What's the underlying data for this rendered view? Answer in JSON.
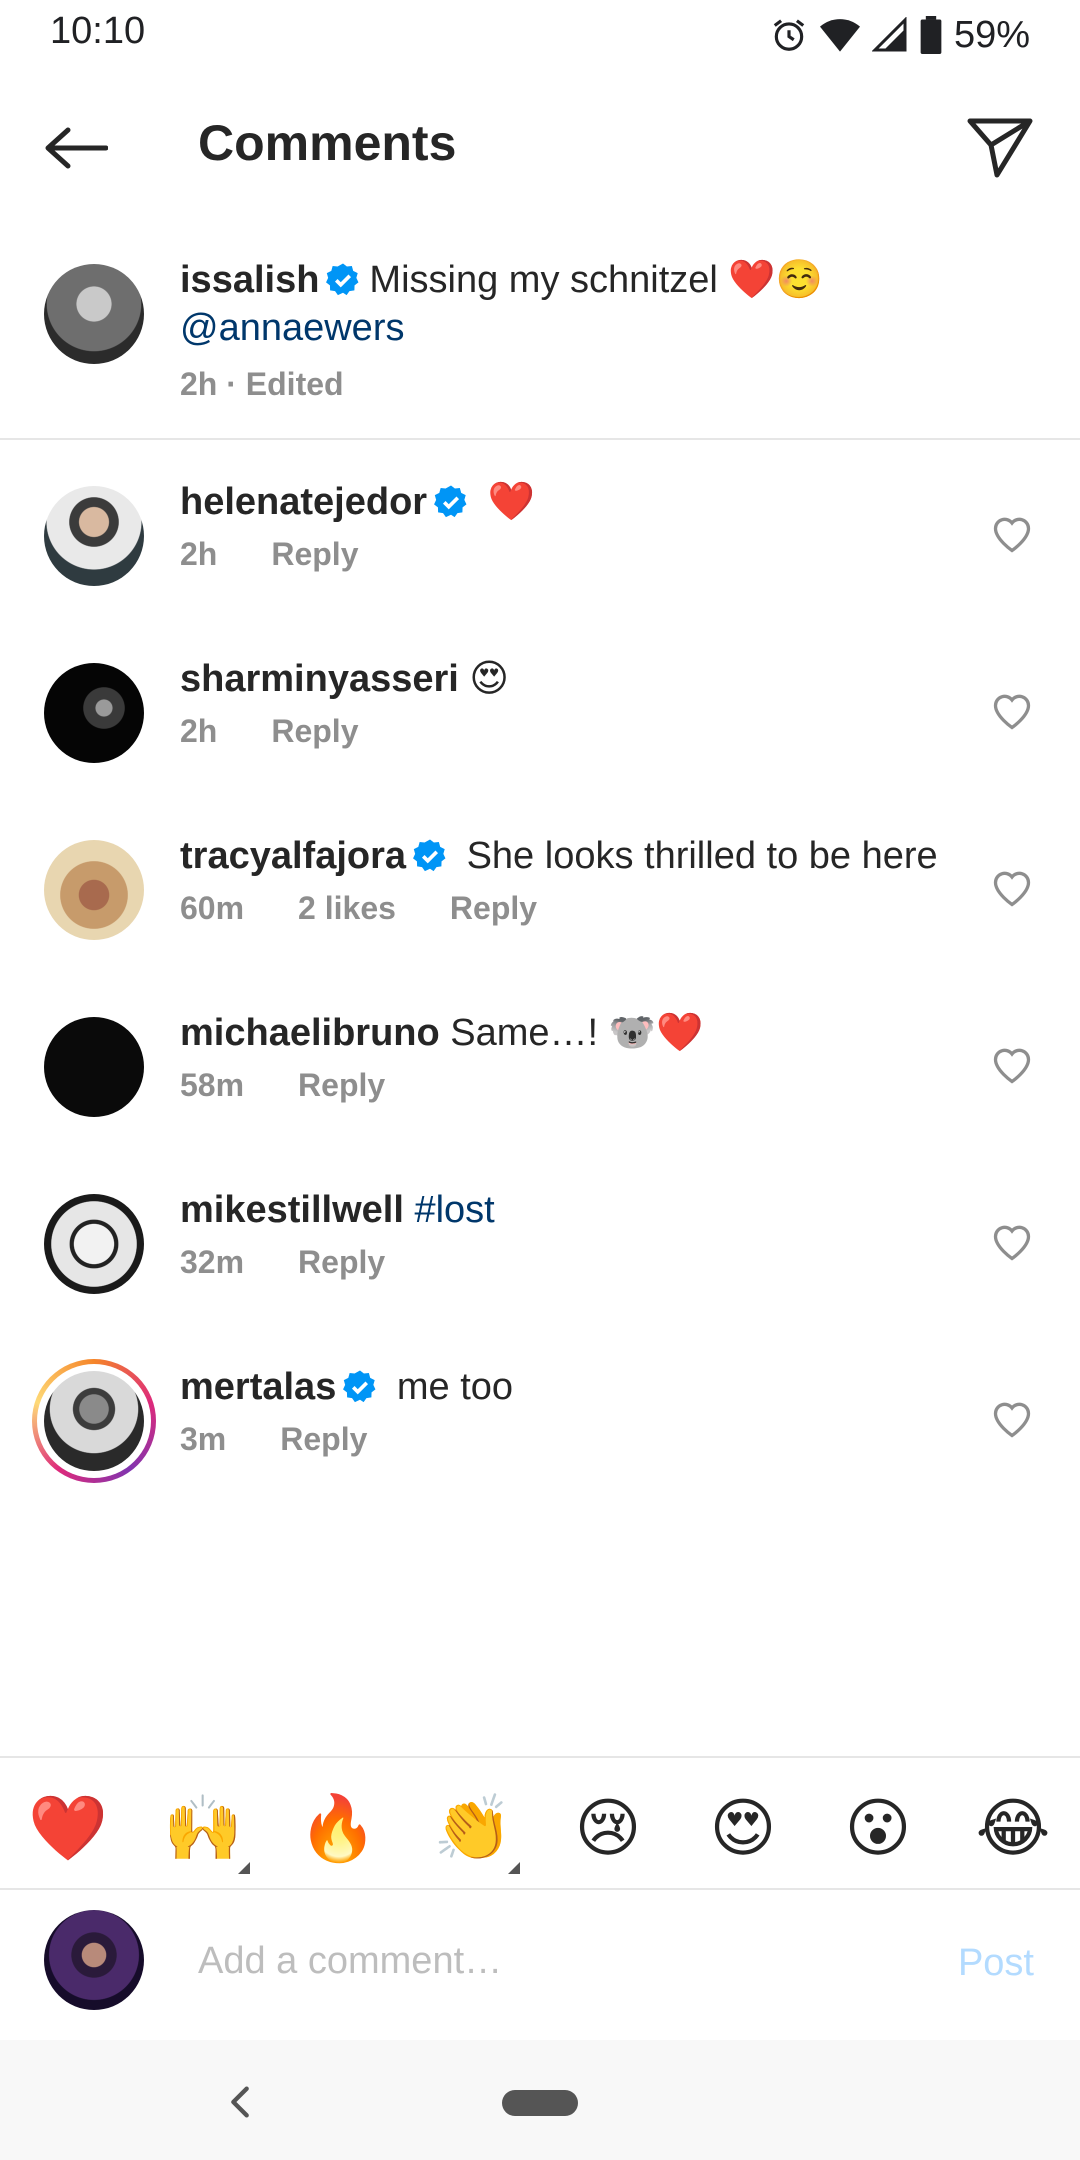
{
  "status_bar": {
    "time": "10:10",
    "battery": "59%",
    "icons": [
      "alarm-icon",
      "wifi-icon",
      "signal-icon",
      "battery-icon"
    ]
  },
  "header": {
    "title": "Comments",
    "back_icon": "arrow-left-icon",
    "send_icon": "paper-plane-icon"
  },
  "caption": {
    "username": "issalish",
    "verified": true,
    "text": "Missing my schnitzel ❤️☺️",
    "mention": "@annaewers",
    "meta": "2h · Edited"
  },
  "comments": [
    {
      "username": "helenatejedor",
      "verified": true,
      "text": "❤️",
      "time": "2h",
      "likes": "",
      "reply": "Reply"
    },
    {
      "username": "sharminyasseri",
      "verified": false,
      "text": "😍",
      "time": "2h",
      "likes": "",
      "reply": "Reply"
    },
    {
      "username": "tracyalfajora",
      "verified": true,
      "text": "She looks thrilled to be here",
      "time": "60m",
      "likes": "2 likes",
      "reply": "Reply"
    },
    {
      "username": "michaelibruno",
      "verified": false,
      "text": "Same…! 🐨❤️",
      "time": "58m",
      "likes": "",
      "reply": "Reply"
    },
    {
      "username": "mikestillwell",
      "verified": false,
      "text": "",
      "hashtag": "#lost",
      "time": "32m",
      "likes": "",
      "reply": "Reply"
    },
    {
      "username": "mertalas",
      "verified": true,
      "text": "me too",
      "time": "3m",
      "likes": "",
      "reply": "Reply"
    }
  ],
  "emoji_bar": [
    "❤️",
    "🙌",
    "🔥",
    "👏",
    "😢",
    "😍",
    "😮",
    "😂"
  ],
  "input": {
    "placeholder": "Add a comment…",
    "value": "",
    "post_label": "Post"
  },
  "colors": {
    "text": "#262626",
    "meta": "#8e8e8e",
    "link": "#00376b",
    "verified": "#0095f6",
    "post_disabled": "#b3dbff"
  }
}
